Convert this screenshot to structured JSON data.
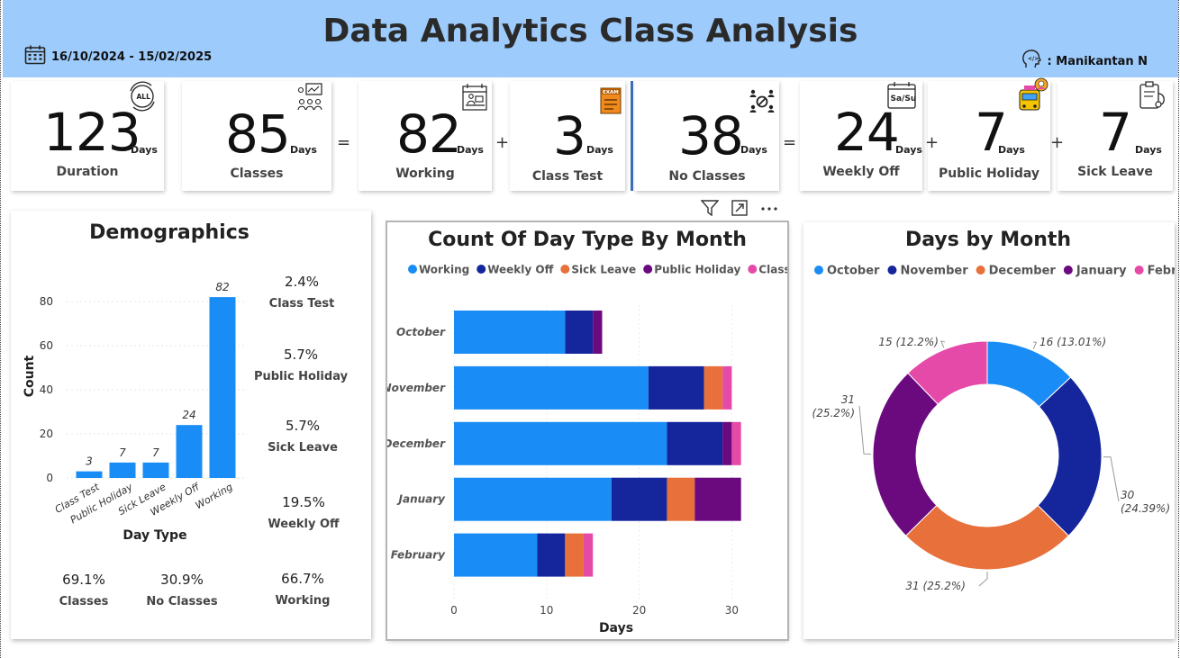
{
  "header": {
    "title": "Data Analytics Class Analysis",
    "date_range": "16/10/2024 - 15/02/2025",
    "author": ": Manikantan N"
  },
  "days_unit": "Days",
  "kpis": [
    {
      "value": "123",
      "label": "Duration",
      "icon": "all-cycle-icon"
    },
    {
      "value": "85",
      "label": "Classes",
      "icon": "classroom-icon"
    },
    {
      "value": "82",
      "label": "Working",
      "icon": "calendar-desk-icon"
    },
    {
      "value": "3",
      "label": "Class Test",
      "icon": "exam-icon"
    },
    {
      "value": "38",
      "label": "No Classes",
      "icon": "no-people-icon"
    },
    {
      "value": "24",
      "label": "Weekly Off",
      "icon": "weekend-calendar-icon"
    },
    {
      "value": "7",
      "label": "Public Holiday",
      "icon": "bus-icon"
    },
    {
      "value": "7",
      "label": "Sick Leave",
      "icon": "medical-report-icon"
    }
  ],
  "operators": [
    "=",
    "+",
    "=",
    "+",
    "+"
  ],
  "demographics": {
    "title": "Demographics",
    "percentages": [
      {
        "value": "2.4%",
        "label": "Class Test"
      },
      {
        "value": "5.7%",
        "label": "Public Holiday"
      },
      {
        "value": "5.7%",
        "label": "Sick Leave"
      },
      {
        "value": "19.5%",
        "label": "Weekly Off"
      },
      {
        "value": "69.1%",
        "label": "Classes"
      },
      {
        "value": "30.9%",
        "label": "No Classes"
      },
      {
        "value": "66.7%",
        "label": "Working"
      }
    ]
  },
  "colors": {
    "working": "#1a8cf5",
    "weekly_off": "#15259b",
    "sick_leave": "#e8703a",
    "public_holiday": "#6b0a7f",
    "class_test": "#e64aa8",
    "october": "#1a8cf5",
    "november": "#15259b",
    "december": "#e8703a",
    "january": "#6b0a7f",
    "february": "#e64aa8"
  },
  "chart_data": [
    {
      "type": "bar",
      "title": "Demographics",
      "xlabel": "Day Type",
      "ylabel": "Count",
      "categories": [
        "Class Test",
        "Public Holiday",
        "Sick Leave",
        "Weekly Off",
        "Working"
      ],
      "values": [
        3,
        7,
        7,
        24,
        82
      ],
      "yticks": [
        0,
        20,
        40,
        60,
        80
      ],
      "ylim": [
        0,
        82
      ],
      "color": "#1a8cf5",
      "grid": true
    },
    {
      "type": "bar",
      "orientation": "horizontal",
      "stacked": true,
      "title": "Count Of Day Type By Month",
      "xlabel": "Days",
      "categories": [
        "October",
        "November",
        "December",
        "January",
        "February"
      ],
      "xticks": [
        0,
        10,
        20,
        30
      ],
      "xlim": [
        0,
        32
      ],
      "legend_position": "top",
      "series": [
        {
          "name": "Working",
          "color": "#1a8cf5",
          "values": [
            12,
            21,
            23,
            17,
            9
          ]
        },
        {
          "name": "Weekly Off",
          "color": "#15259b",
          "values": [
            3,
            6,
            6,
            6,
            3
          ]
        },
        {
          "name": "Sick Leave",
          "color": "#e8703a",
          "values": [
            0,
            2,
            0,
            3,
            2
          ]
        },
        {
          "name": "Public Holiday",
          "color": "#6b0a7f",
          "values": [
            1,
            0,
            1,
            5,
            0
          ]
        },
        {
          "name": "Class Test",
          "color": "#e64aa8",
          "values": [
            0,
            1,
            1,
            0,
            1
          ]
        }
      ]
    },
    {
      "type": "pie",
      "donut": true,
      "title": "Days by Month",
      "legend_position": "top",
      "labels": [
        "October",
        "November",
        "December",
        "January",
        "February"
      ],
      "values": [
        16,
        30,
        31,
        31,
        15
      ],
      "data_labels": [
        "16 (13.01%)",
        "30 (24.39%)",
        "31 (25.2%)",
        "31 (25.2%)",
        "15 (12.2%)"
      ],
      "colors": [
        "#1a8cf5",
        "#15259b",
        "#e8703a",
        "#6b0a7f",
        "#e64aa8"
      ]
    }
  ]
}
